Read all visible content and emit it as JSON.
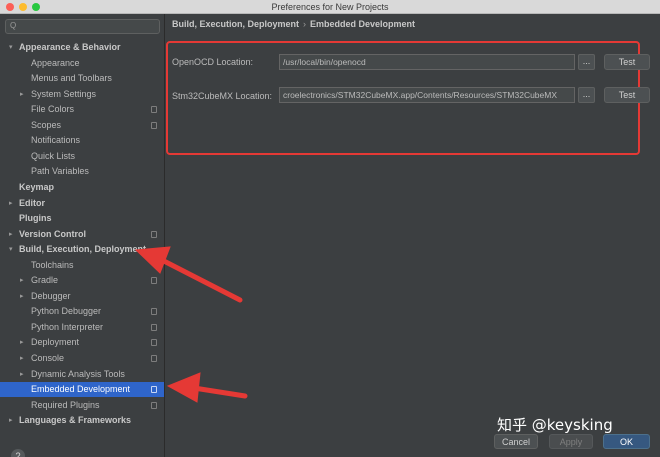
{
  "window": {
    "title": "Preferences for New Projects"
  },
  "search": {
    "placeholder": "Q"
  },
  "sidebar": {
    "items": [
      {
        "label": "Appearance & Behavior",
        "bold": true,
        "arrow": "▾"
      },
      {
        "label": "Appearance"
      },
      {
        "label": "Menus and Toolbars"
      },
      {
        "label": "System Settings",
        "arrow": "▸"
      },
      {
        "label": "File Colors",
        "icon": "copy-icon"
      },
      {
        "label": "Scopes",
        "icon": "copy-icon"
      },
      {
        "label": "Notifications"
      },
      {
        "label": "Quick Lists"
      },
      {
        "label": "Path Variables"
      },
      {
        "label": "Keymap",
        "bold": true
      },
      {
        "label": "Editor",
        "bold": true,
        "arrow": "▸"
      },
      {
        "label": "Plugins",
        "bold": true
      },
      {
        "label": "Version Control",
        "bold": true,
        "arrow": "▸",
        "icon": "copy-icon"
      },
      {
        "label": "Build, Execution, Deployment",
        "bold": true,
        "arrow": "▾"
      },
      {
        "label": "Toolchains"
      },
      {
        "label": "Gradle",
        "arrow": "▸",
        "icon": "copy-icon"
      },
      {
        "label": "Debugger",
        "arrow": "▸"
      },
      {
        "label": "Python Debugger",
        "icon": "copy-icon"
      },
      {
        "label": "Python Interpreter",
        "icon": "copy-icon"
      },
      {
        "label": "Deployment",
        "arrow": "▸",
        "icon": "copy-icon"
      },
      {
        "label": "Console",
        "arrow": "▸",
        "icon": "copy-icon"
      },
      {
        "label": "Dynamic Analysis Tools",
        "arrow": "▸"
      },
      {
        "label": "Embedded Development",
        "selected": true,
        "icon": "copy-icon"
      },
      {
        "label": "Required Plugins",
        "icon": "copy-icon"
      },
      {
        "label": "Languages & Frameworks",
        "bold": true,
        "arrow": "▸"
      }
    ]
  },
  "breadcrumb": {
    "parent": "Build, Execution, Deployment",
    "separator": "›",
    "current": "Embedded Development"
  },
  "openocd": {
    "label": "OpenOCD Location:",
    "value": "/usr/local/bin/openocd",
    "browse_label": "...",
    "test_label": "Test"
  },
  "stm32": {
    "label": "Stm32CubeMX Location:",
    "value": "croelectronics/STM32CubeMX.app/Contents/Resources/STM32CubeMX",
    "browse_label": "...",
    "test_label": "Test"
  },
  "footer": {
    "help_label": "?",
    "cancel_label": "Cancel",
    "apply_label": "Apply",
    "ok_label": "OK"
  },
  "watermark": {
    "text": "知乎 @keysking"
  },
  "colors": {
    "background": "#3c3f41",
    "selection": "#2f65ca",
    "annotation_red": "#e53935",
    "ok_button": "#365880"
  }
}
